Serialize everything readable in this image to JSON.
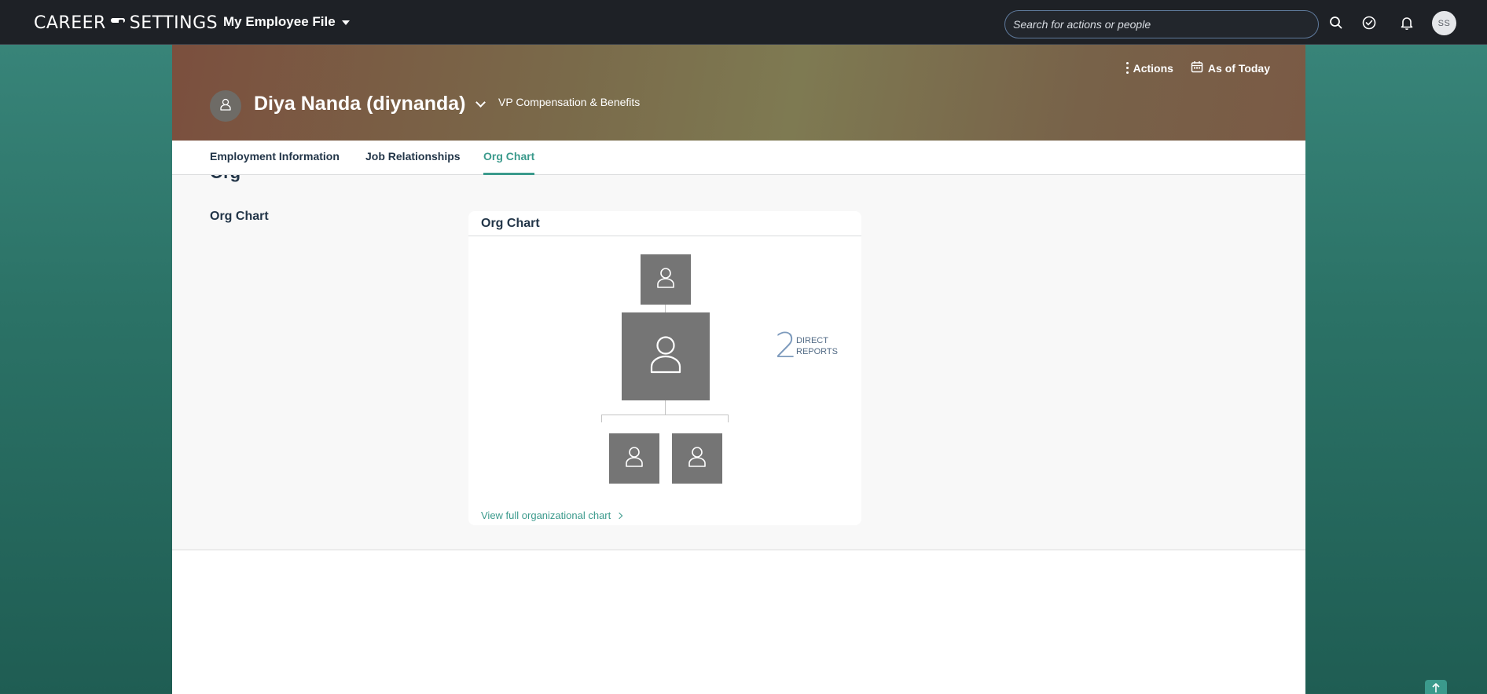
{
  "shellbar": {
    "logo_text_left": "CAREER",
    "logo_text_right": "SETTINGS",
    "menu_label": "My Employee File",
    "search_placeholder": "Search for actions or people",
    "avatar_initials": "SS",
    "icons": [
      "search-icon",
      "task-check-icon",
      "bell-icon"
    ]
  },
  "header": {
    "actions_label": "Actions",
    "as_of_label": "As of Today",
    "name": "Diya Nanda (diynanda)",
    "job_title": "VP Compensation & Benefits"
  },
  "tabs": [
    {
      "label": "Employment Information",
      "active": false
    },
    {
      "label": "Job Relationships",
      "active": false
    },
    {
      "label": "Org Chart",
      "active": true
    }
  ],
  "content": {
    "cut_heading": "Org",
    "section_label": "Org Chart",
    "card": {
      "title": "Org Chart",
      "direct_reports_count": "2",
      "direct_reports_label": "DIRECT REPORTS",
      "view_link": "View full organizational chart"
    }
  },
  "colors": {
    "accent": "#3b9a8c",
    "shell": "#1e2126",
    "node": "#757575",
    "count": "#7e9bbd"
  }
}
